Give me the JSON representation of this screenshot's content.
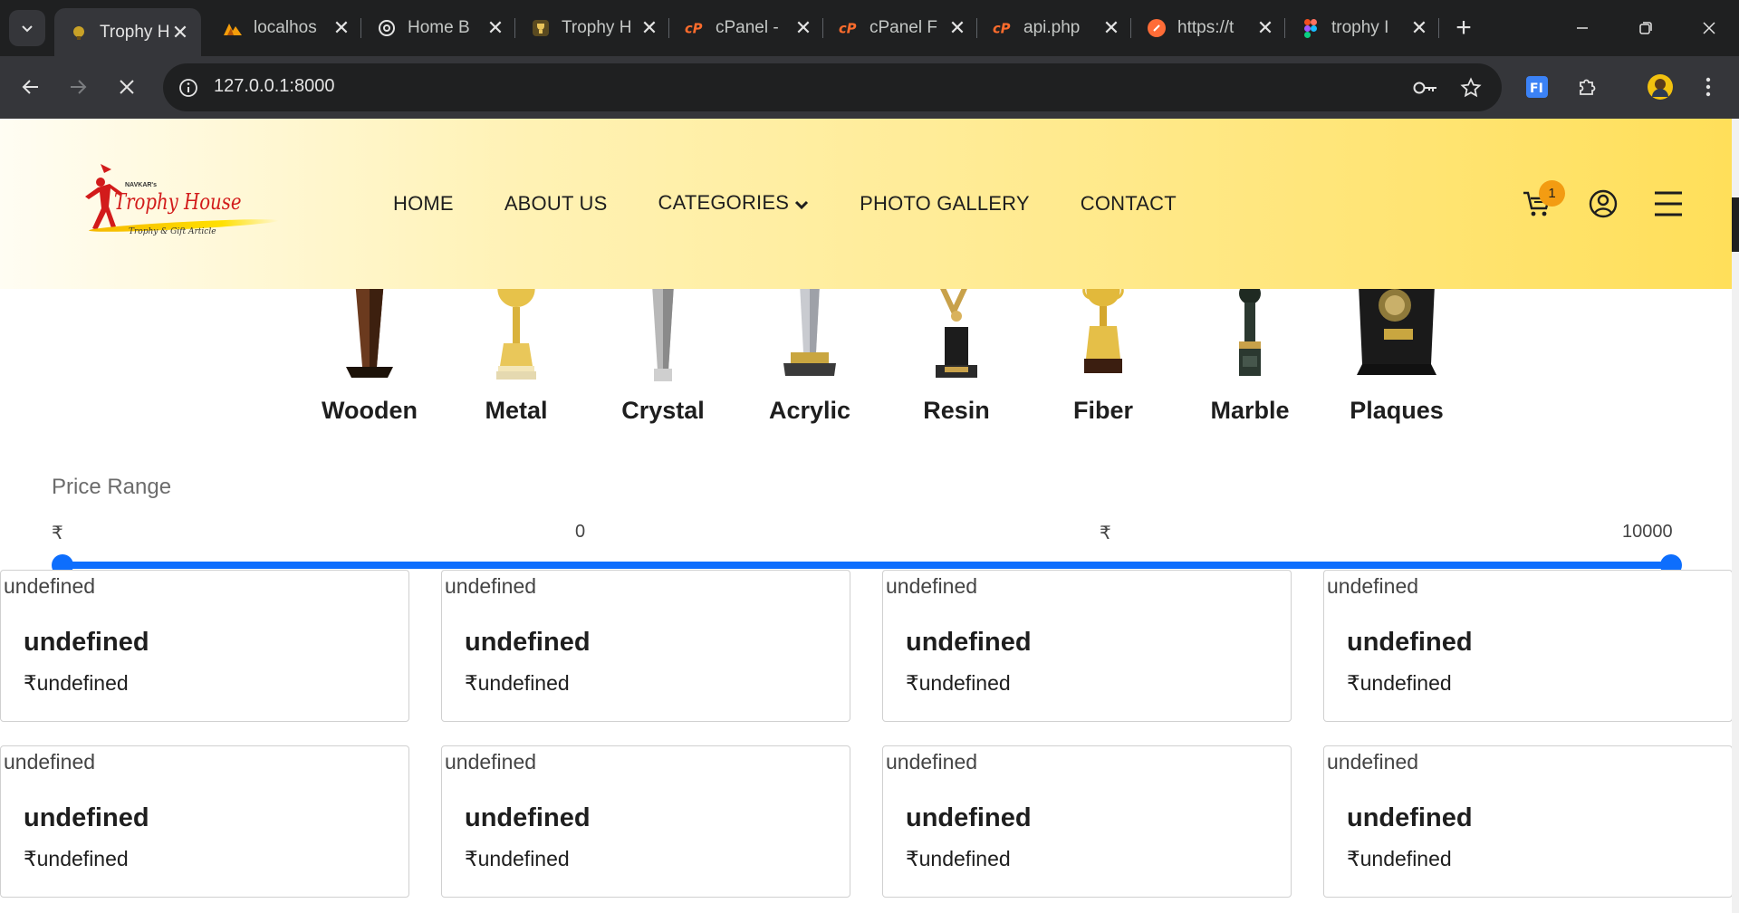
{
  "browser": {
    "tabs": [
      {
        "title": "Trophy H",
        "active": true,
        "icon": "trophy-favicon-icon"
      },
      {
        "title": "localhos",
        "active": false,
        "icon": "mountain-favicon-icon"
      },
      {
        "title": "Home B",
        "active": false,
        "icon": "openai-favicon-icon"
      },
      {
        "title": "Trophy H",
        "active": false,
        "icon": "trophy-favicon-icon"
      },
      {
        "title": "cPanel -",
        "active": false,
        "icon": "cpanel-favicon-icon"
      },
      {
        "title": "cPanel F",
        "active": false,
        "icon": "cpanel-favicon-icon"
      },
      {
        "title": "api.php",
        "active": false,
        "icon": "cpanel-favicon-icon"
      },
      {
        "title": "https://t",
        "active": false,
        "icon": "postman-favicon-icon"
      },
      {
        "title": "trophy I",
        "active": false,
        "icon": "figma-favicon-icon"
      }
    ],
    "url": "127.0.0.1:8000"
  },
  "site": {
    "logo": {
      "small": "NAVKAR's",
      "brand": "Trophy House",
      "tagline": "Trophy & Gift Article"
    },
    "nav": [
      "HOME",
      "ABOUT US",
      "CATEGORIES",
      "PHOTO GALLERY",
      "CONTACT"
    ],
    "cart_count": "1",
    "categories": [
      "Wooden",
      "Metal",
      "Crystal",
      "Acrylic",
      "Resin",
      "Fiber",
      "Marble",
      "Plaques"
    ],
    "price_range": {
      "title": "Price Range",
      "currency": "₹",
      "min": "0",
      "max": "10000"
    },
    "products": [
      {
        "img_alt": "undefined",
        "name": "undefined",
        "price": "₹undefined"
      },
      {
        "img_alt": "undefined",
        "name": "undefined",
        "price": "₹undefined"
      },
      {
        "img_alt": "undefined",
        "name": "undefined",
        "price": "₹undefined"
      },
      {
        "img_alt": "undefined",
        "name": "undefined",
        "price": "₹undefined"
      },
      {
        "img_alt": "undefined",
        "name": "undefined",
        "price": "₹undefined"
      },
      {
        "img_alt": "undefined",
        "name": "undefined",
        "price": "₹undefined"
      },
      {
        "img_alt": "undefined",
        "name": "undefined",
        "price": "₹undefined"
      },
      {
        "img_alt": "undefined",
        "name": "undefined",
        "price": "₹undefined"
      }
    ]
  }
}
